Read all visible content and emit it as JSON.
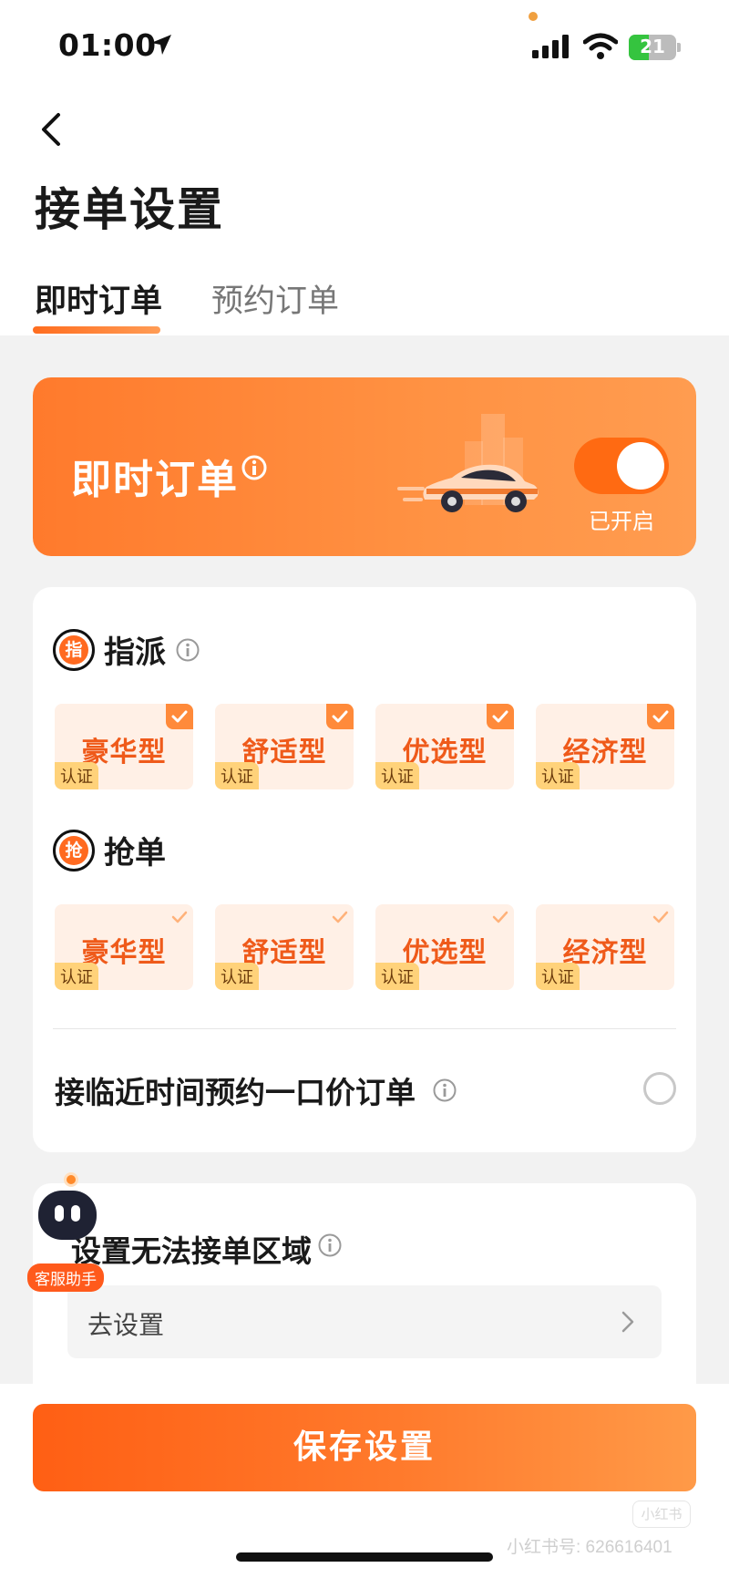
{
  "status_bar": {
    "time": "01:00",
    "battery": "21",
    "icons": [
      "location-arrow-icon",
      "signal-bars-icon",
      "wifi-icon",
      "battery-icon"
    ]
  },
  "header": {
    "title": "接单设置",
    "tabs": [
      {
        "label": "即时订单",
        "active": true
      },
      {
        "label": "预约订单",
        "active": false
      }
    ]
  },
  "banner": {
    "title": "即时订单",
    "toggle_state": "已开启",
    "toggle_on": true
  },
  "dispatch": {
    "badge": "指",
    "title": "指派",
    "options": [
      {
        "label": "豪华型",
        "tag": "认证",
        "checked": true
      },
      {
        "label": "舒适型",
        "tag": "认证",
        "checked": true
      },
      {
        "label": "优选型",
        "tag": "认证",
        "checked": true
      },
      {
        "label": "经济型",
        "tag": "认证",
        "checked": true
      }
    ]
  },
  "grab": {
    "badge": "抢",
    "title": "抢单",
    "options": [
      {
        "label": "豪华型",
        "tag": "认证",
        "checked": false
      },
      {
        "label": "舒适型",
        "tag": "认证",
        "checked": false
      },
      {
        "label": "优选型",
        "tag": "认证",
        "checked": false
      },
      {
        "label": "经济型",
        "tag": "认证",
        "checked": false
      }
    ]
  },
  "fixed_price_option": {
    "label": "接临近时间预约一口价订单",
    "selected": false
  },
  "no_area": {
    "title": "设置无法接单区域",
    "action": "去设置"
  },
  "assistant": {
    "label": "客服助手"
  },
  "footer": {
    "save_label": "保存设置",
    "watermark_logo": "小红书",
    "watermark": "小红书号: 626616401"
  },
  "colors": {
    "accent": "#ff6d1f",
    "banner": "#ff8a3a",
    "chip_bg": "#fff0e6",
    "chip_text": "#ef5a1a",
    "tag_bg": "#ffd27a"
  }
}
